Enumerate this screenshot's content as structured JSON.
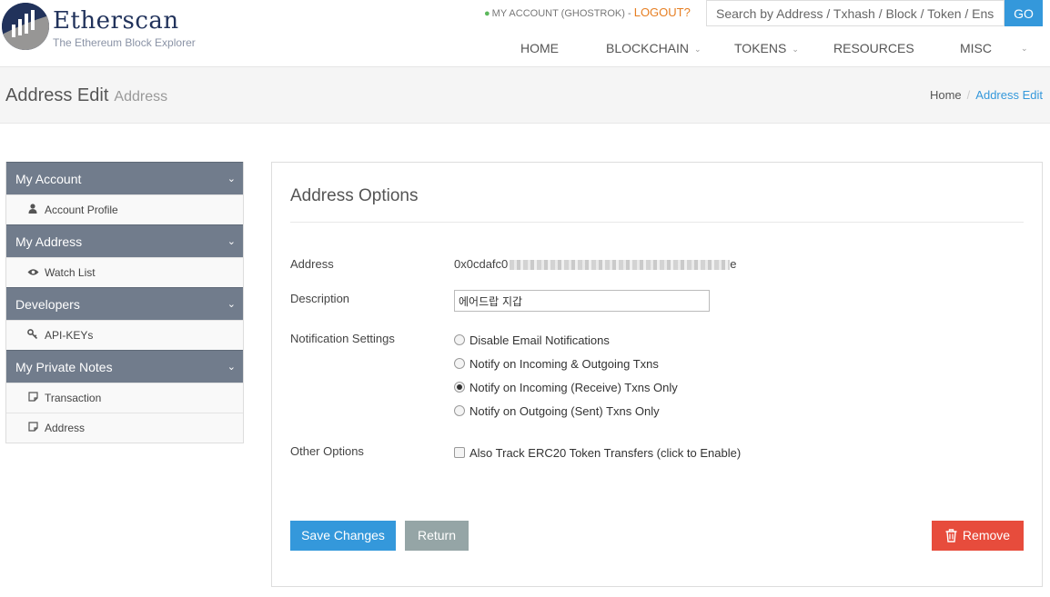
{
  "header": {
    "logo_title": "Etherscan",
    "logo_subtitle": "The Ethereum Block Explorer",
    "account_label": "MY ACCOUNT (GHOSTROK)",
    "account_sep": " - ",
    "logout_label": "LOGOUT?",
    "search_placeholder": "Search by Address / Txhash / Block / Token / Ens",
    "search_button": "GO",
    "nav": {
      "home": "HOME",
      "blockchain": "BLOCKCHAIN",
      "tokens": "TOKENS",
      "resources": "RESOURCES",
      "misc": "MISC"
    }
  },
  "titlebar": {
    "title": "Address Edit",
    "subtitle": "Address",
    "breadcrumb": {
      "home": "Home",
      "sep": "/",
      "current": "Address Edit"
    }
  },
  "sidebar": {
    "my_account": {
      "label": "My Account",
      "items": [
        "Account Profile"
      ]
    },
    "my_address": {
      "label": "My Address",
      "items": [
        "Watch List"
      ]
    },
    "developers": {
      "label": "Developers",
      "items": [
        "API-KEYs"
      ]
    },
    "my_private_notes": {
      "label": "My Private Notes",
      "items": [
        "Transaction",
        "Address"
      ]
    }
  },
  "panel": {
    "title": "Address Options",
    "address_label": "Address",
    "address_prefix": "0x0cdafc0",
    "address_suffix": "e",
    "description_label": "Description",
    "description_value": "에어드랍 지갑",
    "notification_label": "Notification Settings",
    "notification_options": [
      "Disable Email Notifications",
      "Notify on Incoming & Outgoing Txns",
      "Notify on Incoming (Receive) Txns Only",
      "Notify on Outgoing (Sent) Txns Only"
    ],
    "selected_notification_index": 2,
    "other_options_label": "Other Options",
    "erc20_option": "Also Track ERC20 Token Transfers (click to Enable)",
    "erc20_checked": false,
    "save_button": "Save Changes",
    "return_button": "Return",
    "remove_button": "Remove"
  },
  "colors": {
    "brand_navy": "#21325b",
    "accent_blue": "#3498db",
    "logout_orange": "#e67e22",
    "sidebar_header": "#717c8c",
    "return_grey": "#95a5a6",
    "remove_red": "#e74c3c"
  },
  "icons": {
    "account_profile": "user-icon",
    "watch_list": "eye-icon",
    "api_keys": "key-icon",
    "notes": "note-icon",
    "remove": "trash-icon"
  }
}
